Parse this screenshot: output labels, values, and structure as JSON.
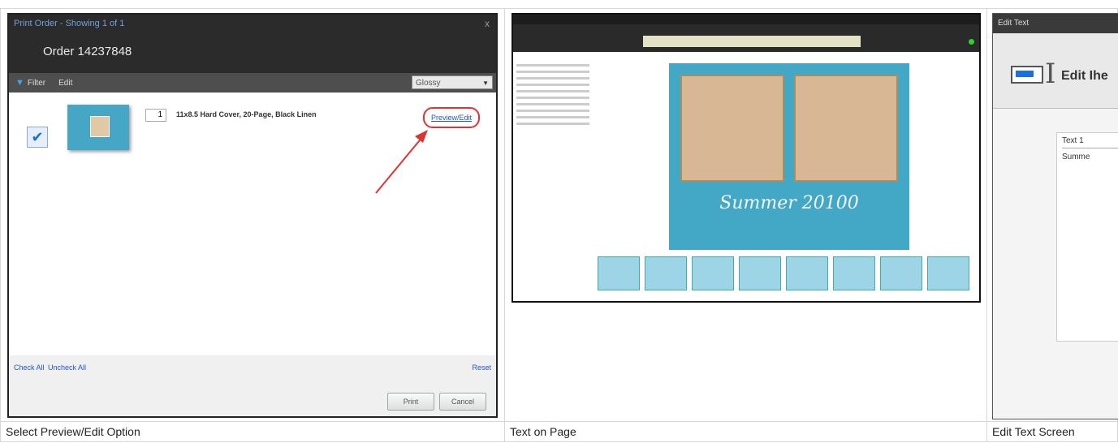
{
  "panel1": {
    "dialog_title": "Print Order - Showing 1 of 1",
    "close_glyph": "x",
    "order": "Order 14237848",
    "toolbar": {
      "filter": "Filter",
      "edit": "Edit",
      "paper": "Glossy"
    },
    "item": {
      "qty": "1",
      "description": "11x8.5 Hard Cover, 20-Page, Black Linen",
      "action": "Preview/Edit"
    },
    "links": {
      "check_all": "Check All",
      "uncheck_all": "Uncheck All",
      "reset": "Reset"
    },
    "buttons": {
      "print": "Print",
      "cancel": "Cancel"
    },
    "caption": "Select Preview/Edit Option"
  },
  "panel2": {
    "page_caption_text": "Summer 20100",
    "caption": "Text on Page"
  },
  "panel3": {
    "title": "Edit Text",
    "heading": "Edit Ihe",
    "field_label": "Text 1",
    "field_value": "Summe",
    "caption": "Edit Text Screen"
  },
  "colors": {
    "accent": "#1f6fd6",
    "highlight": "#dd3333",
    "teal": "#43a7c6"
  }
}
